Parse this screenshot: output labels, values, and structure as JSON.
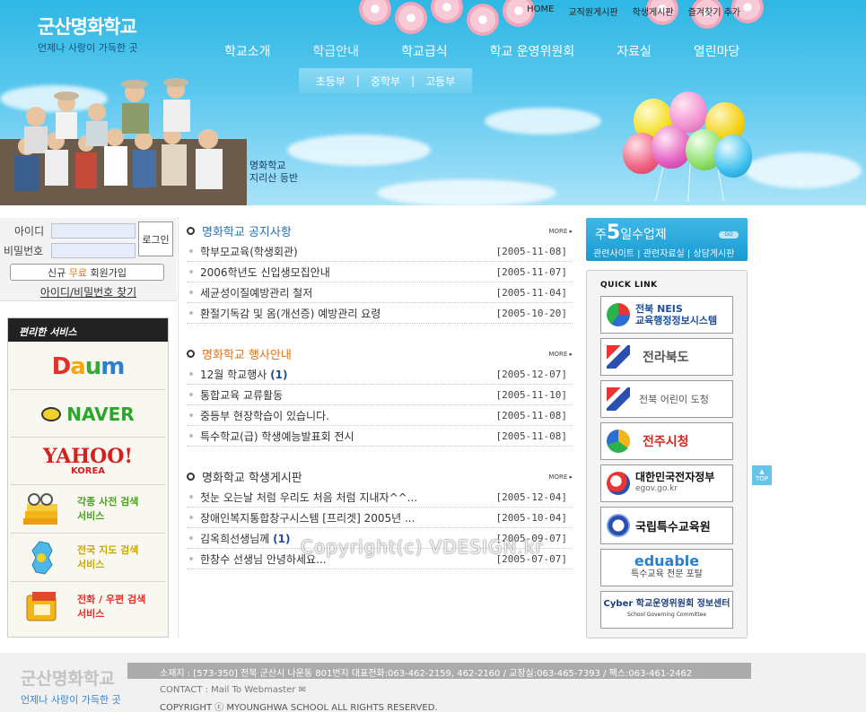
{
  "header": {
    "school_name": "군산명화학교",
    "slogan": "언제나 사랑이 가득한 곳",
    "top_links": [
      "HOME",
      "교직원게시판",
      "학생게시판",
      "즐겨찾기 추가"
    ],
    "gnb": [
      "학교소개",
      "학급안내",
      "학교급식",
      "학교 운영위원회",
      "자료실",
      "열린마당"
    ],
    "subnav": [
      "초등부",
      "중학부",
      "고등부"
    ],
    "subnav_sep": "|",
    "photo_caption_1": "명화학교",
    "photo_caption_2": "지리산 등반"
  },
  "login": {
    "id_label": "아이디",
    "pw_label": "비밀번호",
    "login_button": "로그인",
    "join_prefix": "신규",
    "join_highlight": "무료",
    "join_suffix": "회원가입",
    "find": "아이디/비밀번호 찾기"
  },
  "services": {
    "title": "편리한 서비스",
    "daum": "Daum",
    "naver": "NAVER",
    "yahoo": "YAHOO!",
    "yahoo_sub": "KOREA",
    "dict_1": "각종 사전 검색",
    "dict_2": "서비스",
    "map_1": "전국 지도 검색",
    "map_2": "서비스",
    "phone_1": "전화 / 우편 검색",
    "phone_2": "서비스"
  },
  "boards": [
    {
      "title": "명화학교 공지사항",
      "title_color": "#2a6fb5",
      "more": "MORE ▸",
      "rows": [
        {
          "text": "학부모교육(학생회관)",
          "badge": "",
          "date": "[2005-11-08]"
        },
        {
          "text": "2006학년도 신입생모집안내",
          "badge": "",
          "date": "[2005-11-07]"
        },
        {
          "text": "세균성이질예방관리 철저",
          "badge": "",
          "date": "[2005-11-04]"
        },
        {
          "text": "환절기독감 및 옴(개선증) 예방관리 요령",
          "badge": "",
          "date": "[2005-10-20]"
        }
      ]
    },
    {
      "title": "명화학교 행사안내",
      "title_color": "#e0721b",
      "more": "MORE ▸",
      "rows": [
        {
          "text": "12월 학교행사 ",
          "badge": "(1)",
          "date": "[2005-12-07]"
        },
        {
          "text": "통합교육 교류활동",
          "badge": "",
          "date": "[2005-11-10]"
        },
        {
          "text": "중등부 현장학습이 있습니다.",
          "badge": "",
          "date": "[2005-11-08]"
        },
        {
          "text": "특수학교(급) 학생예능발표회 전시",
          "badge": "",
          "date": "[2005-11-08]"
        }
      ]
    },
    {
      "title": "명화학교 학생게시판",
      "title_color": "#333333",
      "more": "MORE ▸",
      "rows": [
        {
          "text": "첫눈 오는날 처럼 우리도 처음 처럼 지내자^^...",
          "badge": "",
          "date": "[2005-12-04]"
        },
        {
          "text": "장애인복지통합창구시스템 [프리겟] 2005년 ...",
          "badge": "",
          "date": "[2005-10-04]"
        },
        {
          "text": "김옥희선생님께 ",
          "badge": "(1)",
          "date": "[2005-09-07]"
        },
        {
          "text": "한창수 선생님 안녕하세요...",
          "badge": "",
          "date": "[2005-07-07]"
        }
      ]
    }
  ],
  "watermark": "Copyright(c) VDESIGN.kr",
  "week5": {
    "pre": "주",
    "num": "5",
    "post": "일수업제",
    "go": "GO",
    "links": "관련사이트 | 관련자료실 | 상담게시판"
  },
  "quick_link": {
    "title": "QUICK LINK",
    "items": [
      {
        "line1": "전북 NEIS",
        "line2": "교육행정정보시스템",
        "color": "#1f4f9a"
      },
      {
        "line1": "전라북도",
        "line2": "",
        "color": "#555555"
      },
      {
        "line1": "전북 어린이 도청",
        "line2": "",
        "color": "#555555"
      },
      {
        "line1": "전주시청",
        "line2": "",
        "color": "#d42a1e"
      },
      {
        "line1": "대한민국전자정부",
        "line2": "egov.go.kr",
        "color": "#111111"
      },
      {
        "line1": "국립특수교육원",
        "line2": "",
        "color": "#111111"
      },
      {
        "line1": "eduable",
        "line2": "특수교육 전문 포탈",
        "color": "#2a7fd0"
      },
      {
        "line1": "Cyber 학교운영위원회 정보센터",
        "line2": "School Governing Committee",
        "color": "#1b3f7f"
      }
    ]
  },
  "top_button": "TOP",
  "footer": {
    "school_name": "군산명화학교",
    "slogan": "언제나 사랑이 가득한 곳",
    "address": "소재지 : [573-350] 전북 군산시 나운동 801번지   대표전화:063-462-2159, 462-2160 / 교장실:063-465-7393 / 팩스:063-461-2462",
    "contact": "CONTACT : Mail To Webmaster ✉",
    "copyright": "COPYRIGHT ⓒ MYOUNGHWA SCHOOL ALL RIGHTS RESERVED."
  }
}
